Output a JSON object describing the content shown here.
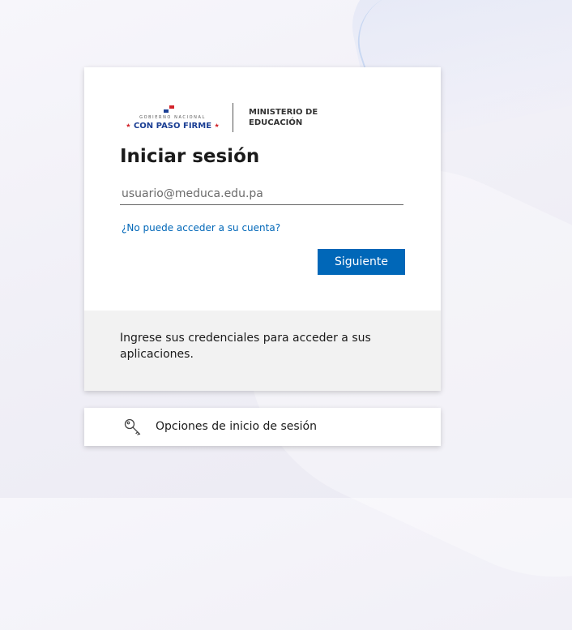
{
  "logo": {
    "gov_line": "GOBIERNO NACIONAL",
    "slogan": "CON PASO FIRME",
    "ministry_line1": "MINISTERIO DE",
    "ministry_line2": "EDUCACIÓN",
    "flag_colors": [
      "#ffffff",
      "#d2232a",
      "#1b3f94"
    ]
  },
  "signin": {
    "title": "Iniciar sesión",
    "email_placeholder": "usuario@meduca.edu.pa",
    "email_value": "",
    "cant_access_link": "¿No puede acceder a su cuenta?",
    "next_button": "Siguiente"
  },
  "footer_text": "Ingrese sus credenciales para acceder a sus aplicaciones.",
  "signin_options": {
    "label": "Opciones de inicio de sesión",
    "icon": "key-icon"
  },
  "colors": {
    "accent": "#0067b8",
    "panel_gray": "#f2f2f2"
  }
}
